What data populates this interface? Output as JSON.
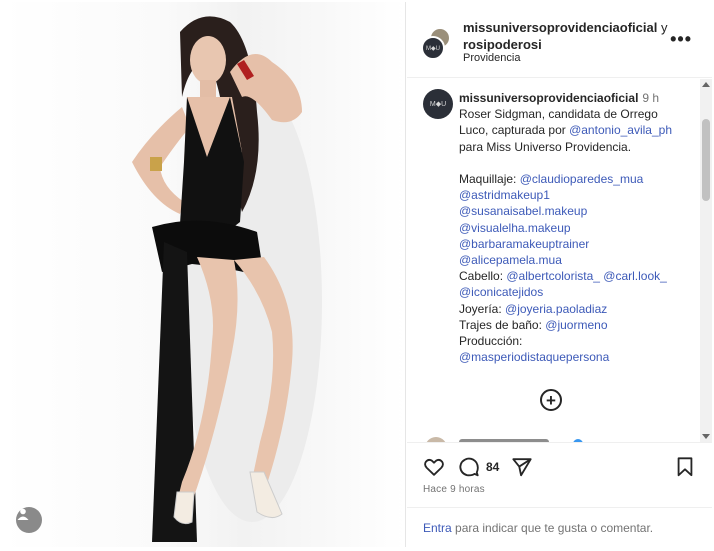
{
  "post": {
    "photo_description": "Photo of woman in black swimsuit",
    "header": {
      "user1": "missuniversoprovidenciaoficial",
      "joiner": "y",
      "user2": "rosipoderosi",
      "location": "Providencia",
      "avatar_text": "M◆U",
      "more_icon": "more-horizontal-icon"
    },
    "caption": {
      "avatar_text": "M◆U",
      "username": "missuniversoprovidenciaoficial",
      "time": "9 h",
      "line1": "Roser Sidgman, candidata de Orrego",
      "line2_text": "Luco, capturada por ",
      "line2_mention": "@antonio_avila_ph",
      "line3": "para Miss Universo Providencia.",
      "maquillaje_label": "Maquillaje: ",
      "maquillaje_mentions": [
        "@claudioparedes_mua",
        "@astridmakeup1",
        "@susanaisabel.makeup",
        "@visualelha.makeup",
        "@barbaramakeuptrainer",
        "@alicepamela.mua"
      ],
      "cabello_label": "Cabello: ",
      "cabello_mention1": "@albertcolorista_",
      "cabello_mention2": "@carl.look_",
      "cabello_mention3": "@iconicatejidos",
      "joyeria_label": "Joyería: ",
      "joyeria_mention": "@joyeria.paoladiaz",
      "trajes_label": "Trajes de baño: ",
      "trajes_mention": "@juormeno",
      "produccion_label": "Producción:",
      "produccion_mention": "@masperiodistaquepersona"
    },
    "actions": {
      "comment_count": "84",
      "time_ago": "Hace 9 horas"
    },
    "login": {
      "link": "Entra",
      "text": " para indicar que te gusta o comentar."
    }
  },
  "colors": {
    "link": "#3d5ab8",
    "text": "#262626",
    "muted": "#737373"
  }
}
